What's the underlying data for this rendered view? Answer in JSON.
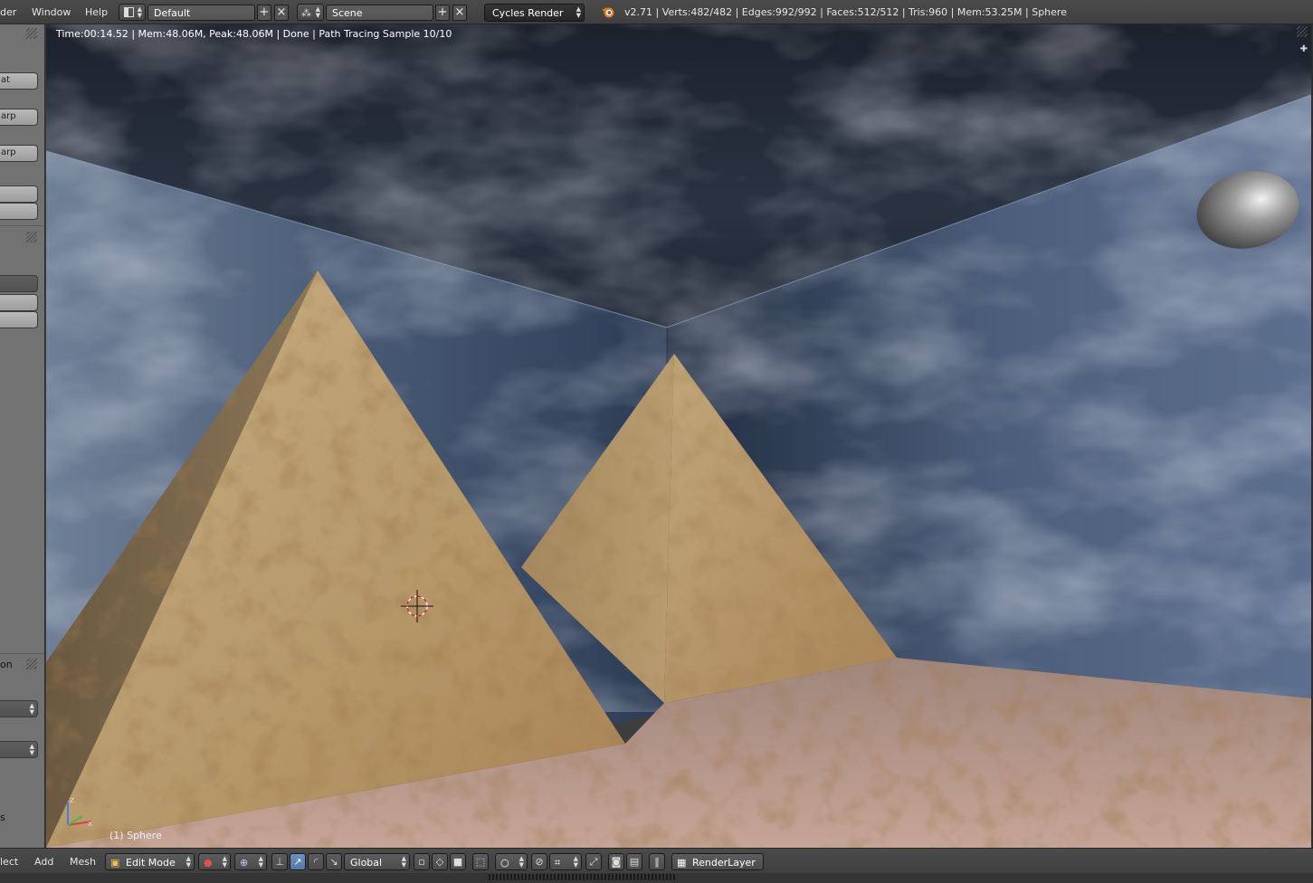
{
  "topbar": {
    "menus": [
      "der",
      "Window",
      "Help"
    ],
    "screen_layout": "Default",
    "scene": "Scene",
    "render_engine": "Cycles Render",
    "stats": "v2.71 | Verts:482/482 | Edges:992/992 | Faces:512/512 | Tris:960 | Mem:53.25M | Sphere",
    "plus_glyph": "+",
    "close_glyph": "×"
  },
  "shelf": {
    "buttons": [
      "at",
      "arp",
      "arp",
      "",
      "",
      "",
      ""
    ],
    "section_label": "on",
    "bottom_label": "s"
  },
  "viewport": {
    "render_status": "Time:00:14.52 | Mem:48.06M, Peak:48.06M | Done | Path Tracing Sample 10/10",
    "object_label": "(1) Sphere",
    "axis_x": "x",
    "axis_z": "z"
  },
  "bottombar": {
    "menus": [
      "lect",
      "Add",
      "Mesh"
    ],
    "mode": "Edit Mode",
    "orientation": "Global",
    "render_layer": "RenderLayer"
  },
  "colors": {
    "header_bg": "#444444",
    "shelf_bg": "#727272",
    "selection_blue": "#5680c2",
    "engine_bg": "#2c2c2c"
  }
}
